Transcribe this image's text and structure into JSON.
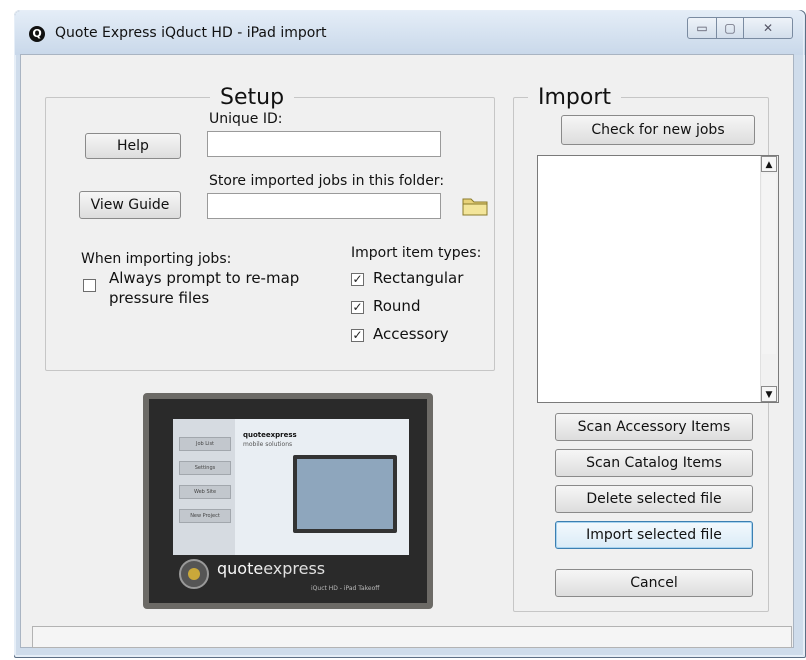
{
  "window": {
    "title": "Quote Express iQduct HD - iPad import",
    "app_icon": "Q",
    "controls": {
      "minimize": "▭",
      "maximize": "▢",
      "close": "✕"
    }
  },
  "setup": {
    "legend": "Setup",
    "help_button": "Help",
    "view_guide_button": "View Guide",
    "unique_id_label": "Unique ID:",
    "unique_id_value": "",
    "folder_label": "Store imported jobs in this folder:",
    "folder_value": "",
    "folder_icon": "folder-icon",
    "when_importing_label": "When importing jobs:",
    "remap_option_line1": "Always prompt to re-map",
    "remap_option_line2": "pressure files",
    "remap_checked": false,
    "item_types_label": "Import item types:",
    "item_types": [
      {
        "label": "Rectangular",
        "checked": true
      },
      {
        "label": "Round",
        "checked": true
      },
      {
        "label": "Accessory",
        "checked": true
      }
    ]
  },
  "import": {
    "legend": "Import",
    "check_jobs_button": "Check for new jobs",
    "jobs_list": [],
    "buttons": [
      "Scan Accessory Items",
      "Scan Catalog Items",
      "Delete selected file",
      "Import selected file",
      "Cancel"
    ]
  },
  "preview": {
    "sidebar_items": [
      "Job List",
      "Settings",
      "Web Site",
      "New Project"
    ],
    "mobile_title": "quoteexpress",
    "mobile_subtitle": "mobile solutions",
    "brand_part1": "quote",
    "brand_part2": "express",
    "tagline": "iQuct HD - iPad Takeoff"
  },
  "colors": {
    "accent": "#3c7fb1",
    "window_frame": "#cfdceb",
    "client_bg": "#f0f0f0"
  }
}
